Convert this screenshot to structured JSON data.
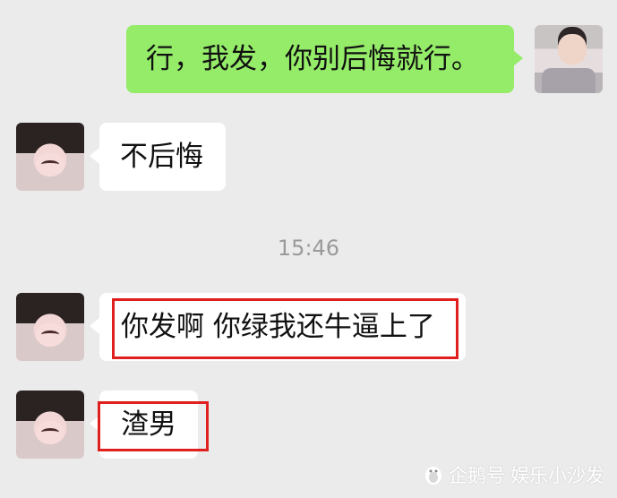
{
  "messages": [
    {
      "sender": "me",
      "text": "行，我发，你别后悔就行。"
    },
    {
      "sender": "other",
      "text": "不后悔"
    },
    {
      "sender": "other",
      "text": "你发啊 你绿我还牛逼上了",
      "highlighted": true
    },
    {
      "sender": "other",
      "text": "渣男",
      "highlighted": true
    }
  ],
  "timestamp": "15:46",
  "watermark": {
    "brand": "企鹅号",
    "account": "娱乐小沙发"
  },
  "colors": {
    "background": "#ebebeb",
    "sent_bubble": "#95ec69",
    "received_bubble": "#ffffff",
    "highlight": "#e0201e"
  }
}
